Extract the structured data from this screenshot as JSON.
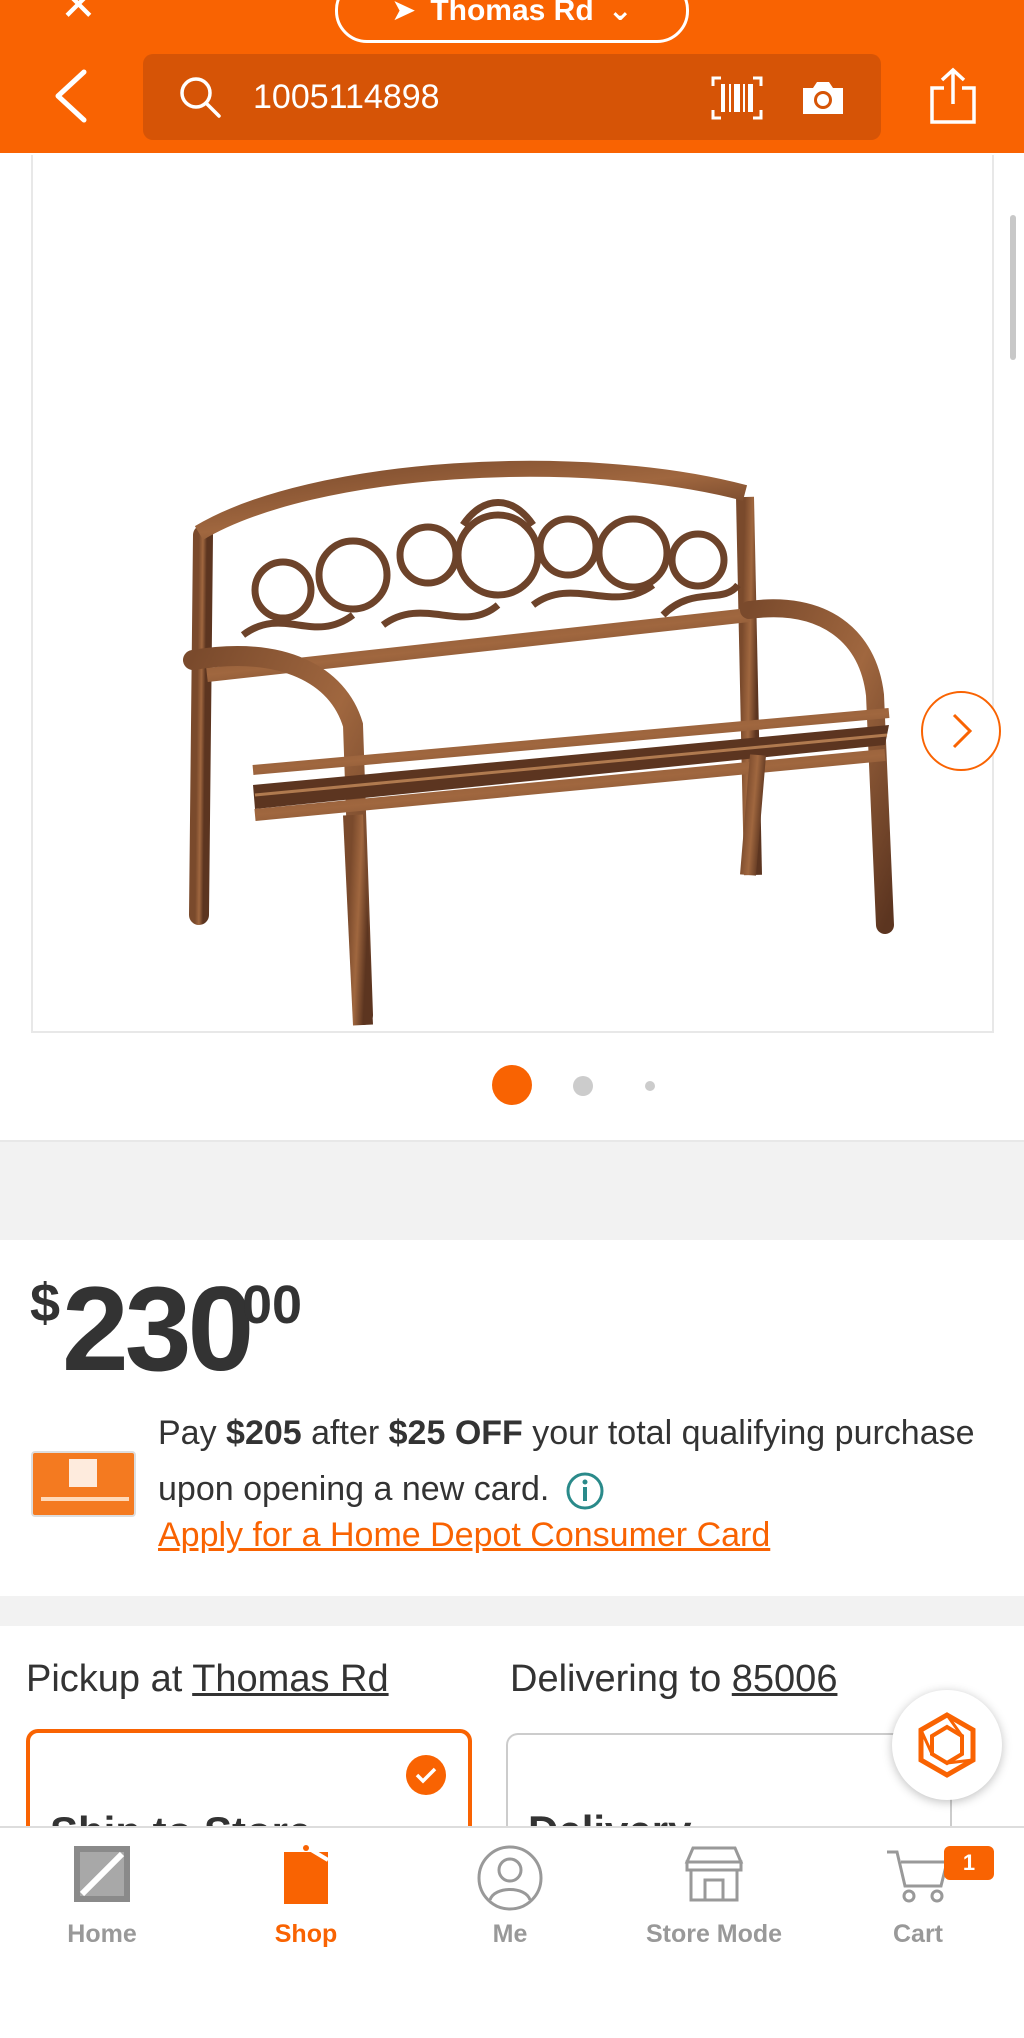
{
  "header": {
    "store_name": "Thomas Rd",
    "search_query": "1005114898"
  },
  "product": {
    "image_count": 3,
    "active_image": 1
  },
  "price": {
    "currency": "$",
    "dollars": "230",
    "cents": "00"
  },
  "promo": {
    "pay_prefix": "Pay",
    "pay_amount": "$205",
    "after": "after",
    "discount": "$25 OFF",
    "rest": "your total qualifying purchase upon opening a new card.",
    "apply_link": "Apply for a Home Depot Consumer Card"
  },
  "fulfillment": {
    "pickup_prefix": "Pickup at",
    "pickup_store": "Thomas Rd",
    "delivery_prefix": "Delivering to",
    "delivery_zip": "85006",
    "option1_title": "Ship to Store",
    "option2_title": "Delivery"
  },
  "nav": {
    "items": [
      {
        "label": "Home"
      },
      {
        "label": "Shop"
      },
      {
        "label": "Me"
      },
      {
        "label": "Store Mode"
      },
      {
        "label": "Cart"
      }
    ],
    "cart_count": "1"
  },
  "colors": {
    "brand": "#f96302",
    "search_bg": "#d65406"
  }
}
